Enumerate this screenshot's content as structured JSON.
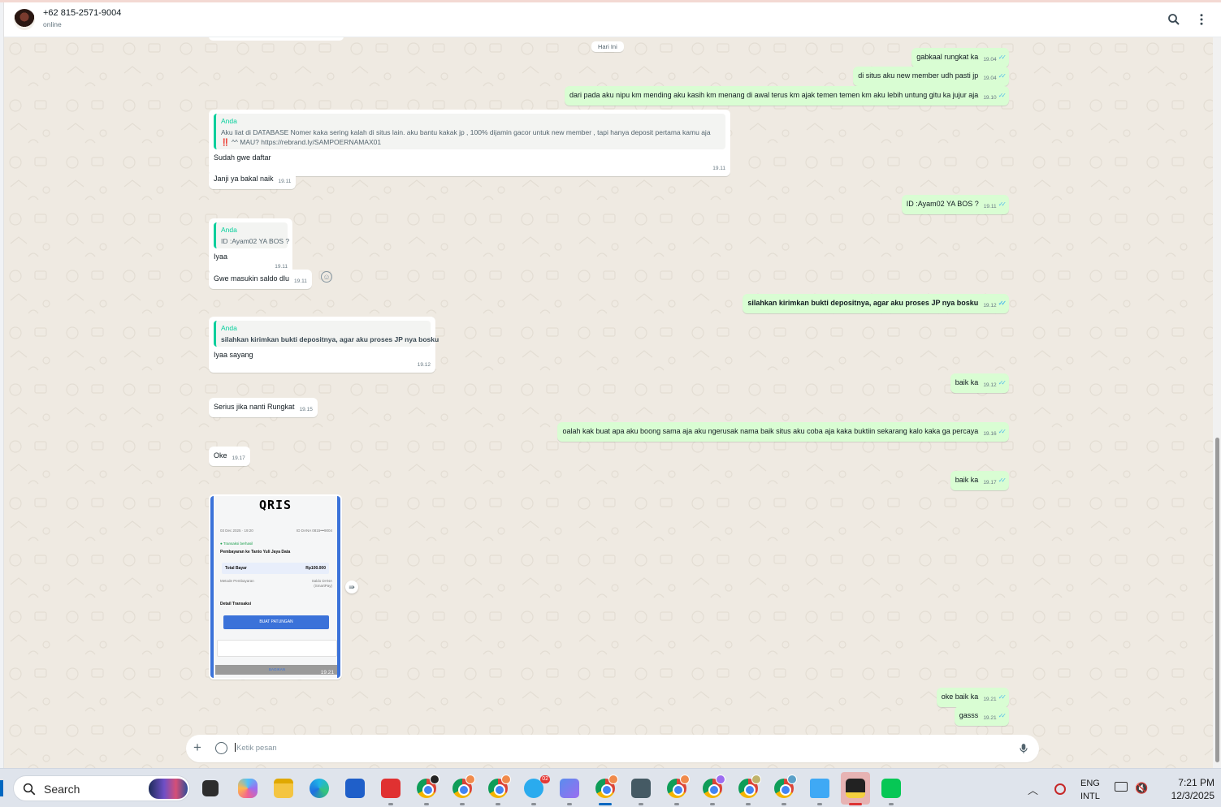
{
  "header": {
    "contact_name": "+62 815-2571-9004",
    "status": "online",
    "icons": [
      "search-icon",
      "more-vertical-icon"
    ]
  },
  "chat": {
    "date_chip": "Hari Ini",
    "messages": [
      {
        "dir": "out",
        "text": "gabkaal rungkat ka",
        "time": "19.04",
        "read": true
      },
      {
        "dir": "out",
        "text": "di situs aku new member udh pasti jp",
        "time": "19.04",
        "read": true
      },
      {
        "dir": "out",
        "text": "dari pada aku nipu km  mending aku kasih km menang di awal terus km ajak temen temen km aku lebih untung gitu ka jujur aja",
        "time": "19.10",
        "read": true
      },
      {
        "dir": "in",
        "quote_author": "Anda",
        "quote_line1": "Aku liat di DATABASE Nomer kaka sering kalah di situs lain. aku bantu kakak jp , 100% dijamin gacor untuk new member , tapi hanya deposit pertama kamu aja",
        "quote_line2": "‼️  ^^ MAU? https://rebrand.ly/SAMPOERNAMAX01",
        "text": "Sudah gwe daftar",
        "time": "19.11"
      },
      {
        "dir": "in",
        "text": "Janji ya bakal naik",
        "time": "19.11"
      },
      {
        "dir": "out",
        "text": "ID :Ayam02 YA BOS ?",
        "time": "19.11",
        "read": true
      },
      {
        "dir": "in",
        "quote_author": "Anda",
        "quote_line1": "ID :Ayam02 YA BOS ?",
        "text": "Iyaa",
        "time": "19.11"
      },
      {
        "dir": "in",
        "text": "Gwe masukin saldo dlu",
        "time": "19.11"
      },
      {
        "dir": "out",
        "text": "silahkan kirimkan bukti depositnya, agar aku proses JP nya bosku",
        "time": "19.12",
        "read": true
      },
      {
        "dir": "in",
        "quote_author": "Anda",
        "quote_line1": "silahkan kirimkan bukti depositnya, agar aku proses JP nya bosku",
        "text": "Iyaa sayang",
        "time": "19.12"
      },
      {
        "dir": "out",
        "text": "baik ka",
        "time": "19.12",
        "read": true
      },
      {
        "dir": "in",
        "text": "Serius jika nanti Rungkat",
        "time": "19.15"
      },
      {
        "dir": "out",
        "text": "oalah kak buat apa aku boong sama aja aku ngerusak nama baik situs aku coba aja kaka buktiin sekarang kalo kaka ga percaya",
        "time": "19.16",
        "read": true
      },
      {
        "dir": "in",
        "text": "Oke",
        "time": "19.17"
      },
      {
        "dir": "out",
        "text": "baik ka",
        "time": "19.17",
        "read": true
      },
      {
        "dir": "in",
        "type": "image",
        "time": "19.21"
      },
      {
        "dir": "out",
        "text": "oke baik ka",
        "time": "19.21",
        "read": true
      },
      {
        "dir": "out",
        "text": "gasss",
        "time": "19.21",
        "read": true
      }
    ],
    "receipt": {
      "logo": "QRIS",
      "date": "03 Dec 2025 · 19:20",
      "id": "ID DANA 0815•••9004",
      "status": "Transaksi berhasil",
      "payee": "Pembayaran ke Tanto Yuli Jaya Data",
      "total_label": "Total Bayar",
      "total_value": "Rp100.000",
      "method_label": "Metode Pembayaran",
      "method_value": "Saldo DANA",
      "method_value2": "(SmartPay)",
      "detail_label": "Detail Transaksi",
      "button": "BUAT PATUNGAN",
      "share": "BAGIKAN"
    }
  },
  "composer": {
    "placeholder": "Ketik pesan",
    "icons": [
      "plus-icon",
      "sticker-icon",
      "mic-icon"
    ]
  },
  "taskbar": {
    "search_label": "Search",
    "telegram_badge": "02",
    "tray_lang_1": "ENG",
    "tray_lang_2": "INTL",
    "time": "7:21 PM",
    "date": "12/3/2025",
    "colors": {
      "accent": "#0067c0",
      "bubble_out": "#d9fdd3",
      "bubble_in": "#ffffff",
      "chat_bg": "#efeae2"
    }
  }
}
